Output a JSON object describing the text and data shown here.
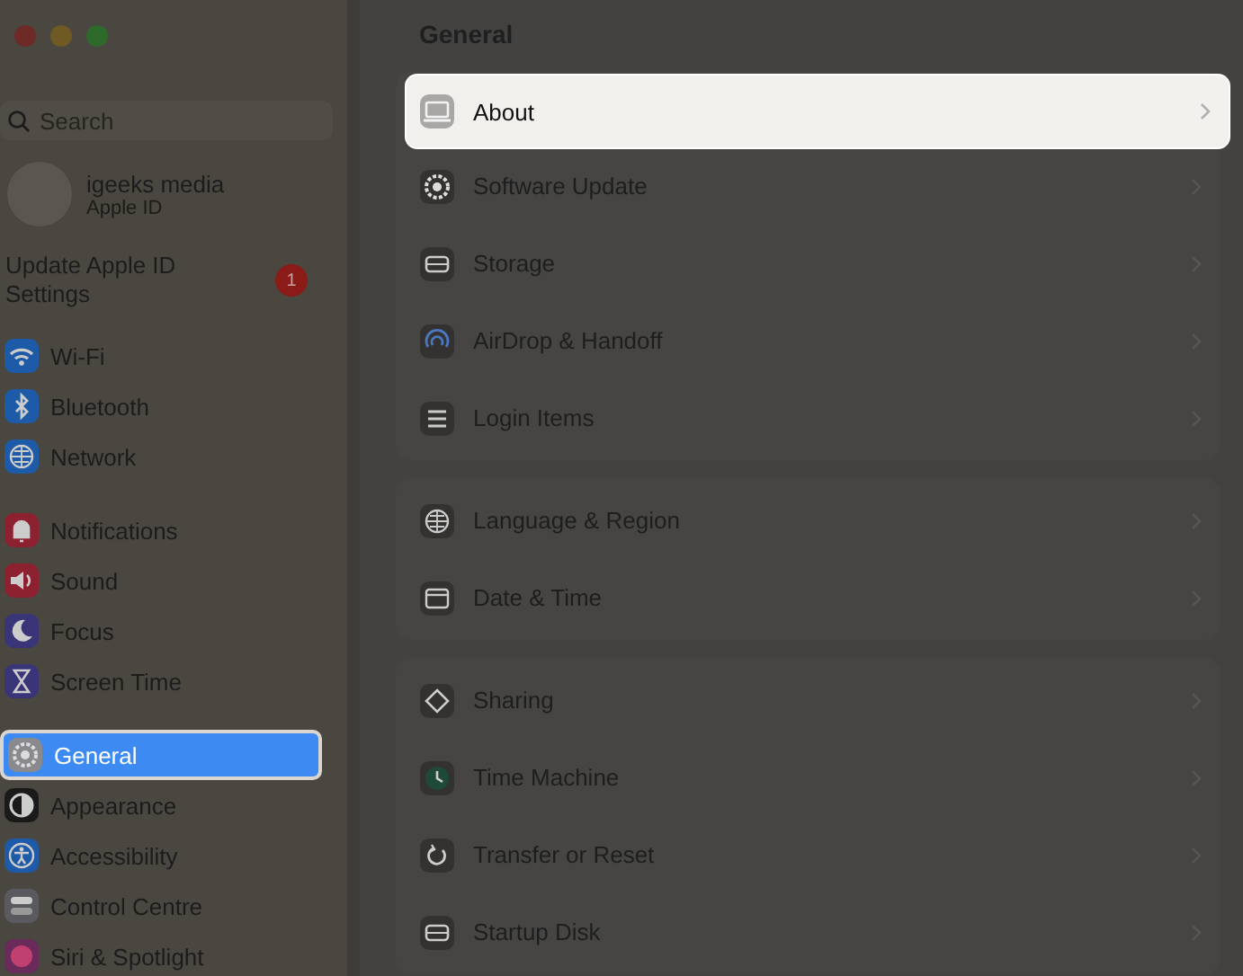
{
  "sidebar": {
    "search": {
      "placeholder": "Search"
    },
    "account": {
      "name": "igeeks media",
      "subtitle": "Apple ID"
    },
    "notice": {
      "text": "Update Apple ID Settings",
      "badge": "1"
    },
    "groups": [
      [
        {
          "label": "Wi-Fi",
          "kind": "wifi",
          "color": "#1d5aa8",
          "selected": false
        },
        {
          "label": "Bluetooth",
          "kind": "bluetooth",
          "color": "#1d5aa8",
          "selected": false
        },
        {
          "label": "Network",
          "kind": "globe",
          "color": "#1d5aa8",
          "selected": false
        }
      ],
      [
        {
          "label": "Notifications",
          "kind": "bell",
          "color": "#8e2130",
          "selected": false
        },
        {
          "label": "Sound",
          "kind": "speaker",
          "color": "#8e2130",
          "selected": false
        },
        {
          "label": "Focus",
          "kind": "moon",
          "color": "#3a3478",
          "selected": false
        },
        {
          "label": "Screen Time",
          "kind": "hourglass",
          "color": "#3a3478",
          "selected": false
        }
      ],
      [
        {
          "label": "General",
          "kind": "gear",
          "color": "#8a8a8e",
          "selected": true
        },
        {
          "label": "Appearance",
          "kind": "circle",
          "color": "#1a1a1a",
          "selected": false
        },
        {
          "label": "Accessibility",
          "kind": "person",
          "color": "#1d5aa8",
          "selected": false
        },
        {
          "label": "Control Centre",
          "kind": "toggles",
          "color": "#5a5a5e",
          "selected": false
        },
        {
          "label": "Siri & Spotlight",
          "kind": "orb",
          "color": "#6a2a5a",
          "selected": false
        }
      ]
    ]
  },
  "content": {
    "title": "General",
    "groups": [
      [
        {
          "label": "About",
          "kind": "laptop",
          "highlighted": true
        },
        {
          "label": "Software Update",
          "kind": "gear",
          "highlighted": false
        },
        {
          "label": "Storage",
          "kind": "drive",
          "highlighted": false
        },
        {
          "label": "AirDrop & Handoff",
          "kind": "airdrop",
          "highlighted": false
        },
        {
          "label": "Login Items",
          "kind": "list",
          "highlighted": false
        }
      ],
      [
        {
          "label": "Language & Region",
          "kind": "globe",
          "highlighted": false
        },
        {
          "label": "Date & Time",
          "kind": "calendar",
          "highlighted": false
        }
      ],
      [
        {
          "label": "Sharing",
          "kind": "diamond",
          "highlighted": false
        },
        {
          "label": "Time Machine",
          "kind": "clock",
          "highlighted": false
        },
        {
          "label": "Transfer or Reset",
          "kind": "reset",
          "highlighted": false
        },
        {
          "label": "Startup Disk",
          "kind": "drive",
          "highlighted": false
        }
      ]
    ]
  }
}
